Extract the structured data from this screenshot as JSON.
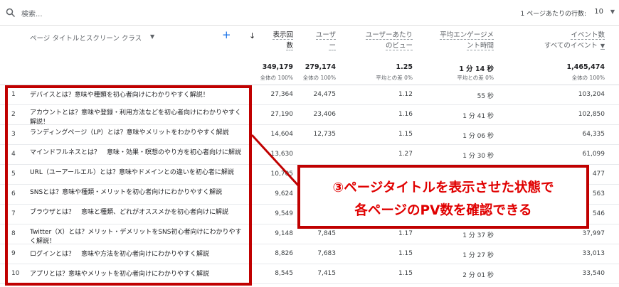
{
  "search": {
    "placeholder": "検索..."
  },
  "rows_per_page": {
    "label": "1 ページあたりの行数:",
    "value": "10"
  },
  "header": {
    "dimension": "ページ タイトルとスクリーン クラス",
    "views_l1": "表示回",
    "views_l2": "数",
    "users_l1": "ユーザ",
    "users_l2": "ー",
    "vpu_l1": "ユーザーあたり",
    "vpu_l2": "のビュー",
    "eng_l1": "平均エンゲージメ",
    "eng_l2": "ント時間",
    "events_l1": "イベント数",
    "events_l2": "すべてのイベント"
  },
  "totals": {
    "views": "349,179",
    "views_sub": "全体の 100%",
    "users": "279,174",
    "users_sub": "全体の 100%",
    "vpu": "1.25",
    "vpu_sub": "平均との差 0%",
    "eng": "1 分 14 秒",
    "eng_sub": "平均との差 0%",
    "events": "1,465,474",
    "events_sub": "全体の 100%"
  },
  "rows": [
    {
      "n": "1",
      "title": "デバイスとは？意味や種類を初心者向けにわかりやすく解説！",
      "views": "27,364",
      "users": "24,475",
      "vpu": "1.12",
      "eng": "55 秒",
      "events": "103,204"
    },
    {
      "n": "2",
      "title": "アカウントとは？意味や登録・利用方法などを初心者向けにわかりやすく解説！",
      "views": "27,190",
      "users": "23,406",
      "vpu": "1.16",
      "eng": "1 分 41 秒",
      "events": "102,850"
    },
    {
      "n": "3",
      "title": "ランディングページ（LP）とは？意味やメリットをわかりやすく解説",
      "views": "14,604",
      "users": "12,735",
      "vpu": "1.15",
      "eng": "1 分 06 秒",
      "events": "64,335"
    },
    {
      "n": "4",
      "title": "マインドフルネスとは？　意味・効果・瞑想のやり方を初心者向けに解説",
      "views": "13,630",
      "users": "",
      "vpu": "1.27",
      "eng": "1 分 30 秒",
      "events": "61,099"
    },
    {
      "n": "5",
      "title": "URL（ユーアールエル）とは？意味やドメインとの違いを初心者に解説",
      "views": "10,705",
      "users": "",
      "vpu": "",
      "eng": "",
      "events": "477"
    },
    {
      "n": "6",
      "title": "SNSとは？意味や種類・メリットを初心者向けにわかりやすく解説",
      "views": "9,624",
      "users": "",
      "vpu": "",
      "eng": "",
      "events": "563"
    },
    {
      "n": "7",
      "title": "ブラウザとは？　意味と種類、どれがオススメかを初心者向けに解説",
      "views": "9,549",
      "users": "",
      "vpu": "",
      "eng": "",
      "events": "546"
    },
    {
      "n": "8",
      "title": "Twitter（X）とは？メリット・デメリットをSNS初心者向けにわかりやすく解説！",
      "views": "9,148",
      "users": "7,845",
      "vpu": "1.17",
      "eng": "1 分 37 秒",
      "events": "37,997"
    },
    {
      "n": "9",
      "title": "ログインとは？　意味や方法を初心者向けにわかりやすく解説",
      "views": "8,826",
      "users": "7,683",
      "vpu": "1.15",
      "eng": "1 分 27 秒",
      "events": "33,013"
    },
    {
      "n": "10",
      "title": "アプリとは？意味やメリットを初心者向けにわかりやすく解説",
      "views": "8,545",
      "users": "7,415",
      "vpu": "1.15",
      "eng": "2 分 01 秒",
      "events": "33,540"
    }
  ],
  "callout": {
    "line1": "③ページタイトルを表示させた状態で",
    "line2": "各ページのPV数を確認できる",
    "color": "#e00000"
  }
}
